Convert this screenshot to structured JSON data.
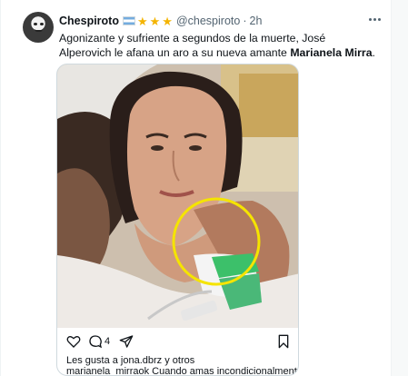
{
  "tweet": {
    "display_name": "Chespiroto",
    "badges": {
      "flag": "argentina-flag-icon",
      "stars": [
        "★",
        "★",
        "★"
      ],
      "star_color": "#f4b400"
    },
    "handle": "@chespiroto",
    "separator": "·",
    "time": "2h",
    "text_part1": "Agonizante y sufriente a segundos de la muerte, José Alperovich le afana un aro a su nueva amante ",
    "text_bold": "Marianela Mirra",
    "text_end": "."
  },
  "embed": {
    "photo_alt": "hospital-selfie-image",
    "highlight_color": "#f5e400",
    "actions": {
      "like_icon": "heart-icon",
      "comment_icon": "comment-icon",
      "comment_count": "4",
      "share_icon": "send-icon",
      "save_icon": "bookmark-icon"
    },
    "likes_text": "Les gusta a jona.dbrz y otros",
    "caption_user": "marianela_mirraok",
    "caption_text": " Cuando amas incondicionalmente ,"
  },
  "colors": {
    "text_primary": "#0f1419",
    "text_secondary": "#536471",
    "border": "#cfd9de"
  }
}
